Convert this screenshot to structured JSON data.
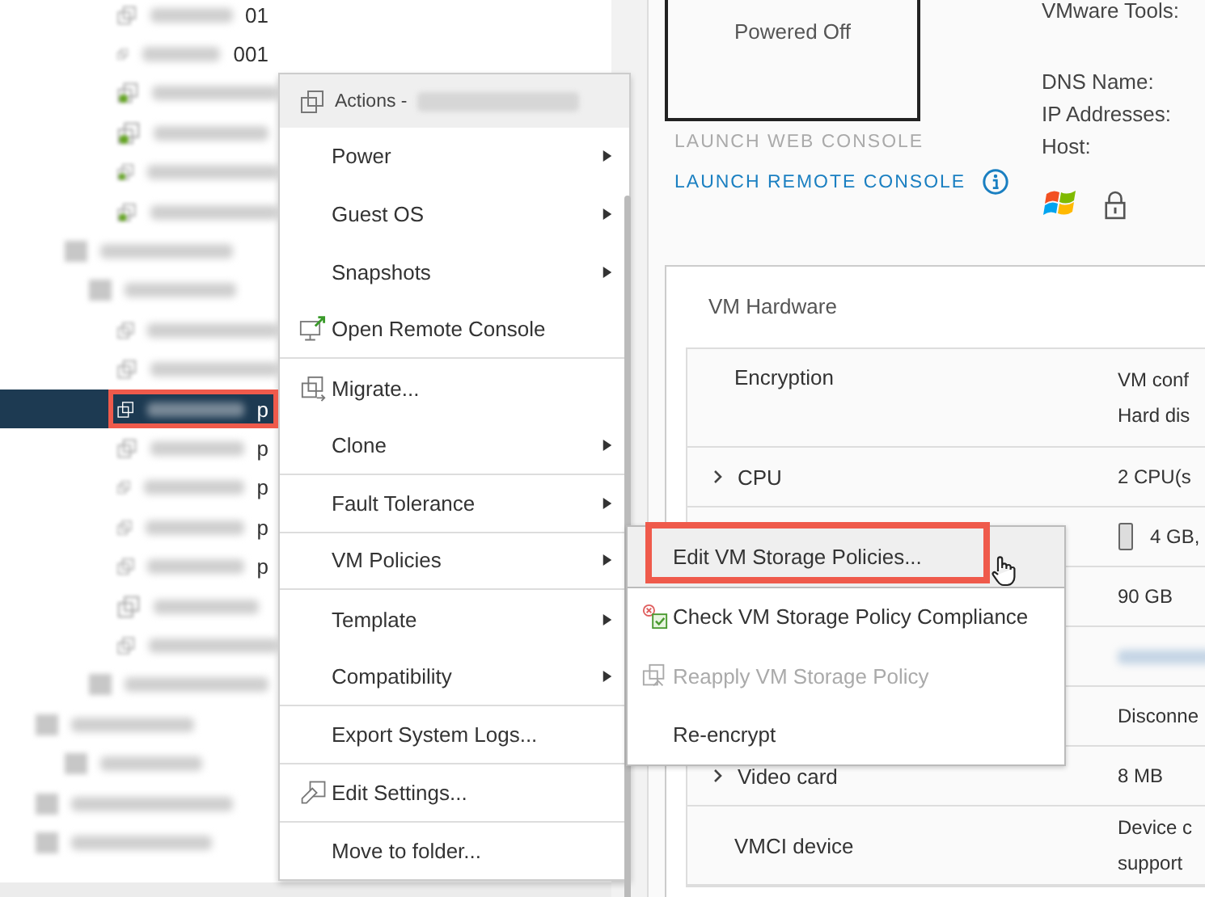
{
  "tree": {
    "rows": [
      {
        "kind": "vm",
        "text": "01",
        "selected": false
      },
      {
        "kind": "vm",
        "text": "001",
        "selected": false
      },
      {
        "kind": "vm-on",
        "selected": false
      },
      {
        "kind": "vm-on",
        "selected": false
      },
      {
        "kind": "vm-on",
        "selected": false
      },
      {
        "kind": "vm-on",
        "selected": false
      },
      {
        "kind": "host",
        "selected": false
      },
      {
        "kind": "pool",
        "selected": false
      },
      {
        "kind": "vm",
        "selected": false
      },
      {
        "kind": "vm",
        "selected": false
      },
      {
        "kind": "vm",
        "text": "p",
        "selected": true
      },
      {
        "kind": "vm",
        "text": "p",
        "selected": false
      },
      {
        "kind": "vm",
        "text": "p",
        "selected": false
      },
      {
        "kind": "vm",
        "text": "p",
        "selected": false
      },
      {
        "kind": "vm",
        "text": "p",
        "selected": false
      },
      {
        "kind": "vm",
        "selected": false
      },
      {
        "kind": "vm",
        "selected": false
      },
      {
        "kind": "pool",
        "selected": false
      },
      {
        "kind": "cluster",
        "selected": false
      },
      {
        "kind": "host",
        "selected": false
      },
      {
        "kind": "cluster",
        "selected": false
      },
      {
        "kind": "cluster",
        "selected": false
      }
    ]
  },
  "console": {
    "status": "Powered Off",
    "links": [
      {
        "label": "LAUNCH WEB CONSOLE",
        "disabled": true
      },
      {
        "label": "LAUNCH REMOTE CONSOLE",
        "disabled": false
      }
    ]
  },
  "summary_labels": [
    "VMware Tools:",
    "DNS Name:",
    "IP Addresses:",
    "Host:"
  ],
  "vm_hardware": {
    "title": "VM Hardware",
    "rows": [
      {
        "label": "Encryption",
        "values": [
          "VM conf",
          "Hard dis"
        ],
        "expandable": false
      },
      {
        "label": "CPU",
        "values": [
          "2 CPU(s"
        ],
        "expandable": true
      },
      {
        "kind": "memory",
        "values": [
          "4 GB,"
        ]
      },
      {
        "values": [
          "90 GB"
        ]
      },
      {
        "kind": "redacted",
        "values": []
      },
      {
        "values": [
          "Disconne"
        ]
      },
      {
        "label": "Video card",
        "values": [
          "8 MB"
        ],
        "expandable": true
      },
      {
        "label": "VMCI device",
        "values": [
          "Device c",
          "support"
        ],
        "expandable": false
      }
    ]
  },
  "context_menu": {
    "title": "Actions -",
    "items": [
      {
        "label": "Power",
        "submenu": true,
        "kind": "plain",
        "divider_after": false
      },
      {
        "label": "Guest OS",
        "submenu": true,
        "kind": "plain",
        "divider_after": false
      },
      {
        "label": "Snapshots",
        "submenu": true,
        "kind": "plain",
        "divider_after": false
      },
      {
        "label": "Open Remote Console",
        "submenu": false,
        "kind": "console",
        "divider_after": true
      },
      {
        "label": "Migrate...",
        "submenu": false,
        "kind": "migrate",
        "divider_after": false
      },
      {
        "label": "Clone",
        "submenu": true,
        "kind": "plain",
        "divider_after": true
      },
      {
        "label": "Fault Tolerance",
        "submenu": true,
        "kind": "plain",
        "divider_after": true
      },
      {
        "label": "VM Policies",
        "submenu": true,
        "kind": "plain",
        "divider_after": true
      },
      {
        "label": "Template",
        "submenu": true,
        "kind": "plain",
        "divider_after": false
      },
      {
        "label": "Compatibility",
        "submenu": true,
        "kind": "plain",
        "divider_after": true
      },
      {
        "label": "Export System Logs...",
        "submenu": false,
        "kind": "plain",
        "divider_after": true
      },
      {
        "label": "Edit Settings...",
        "submenu": false,
        "kind": "settings",
        "divider_after": true
      },
      {
        "label": "Move to folder...",
        "submenu": false,
        "kind": "plain",
        "divider_after": false
      }
    ]
  },
  "submenu": {
    "items": [
      {
        "label": "Edit VM Storage Policies...",
        "kind": "plain",
        "selected": true,
        "disabled": false
      },
      {
        "label": "Check VM Storage Policy Compliance",
        "kind": "check",
        "selected": false,
        "disabled": false
      },
      {
        "label": "Reapply VM Storage Policy",
        "kind": "reapply",
        "selected": false,
        "disabled": true
      },
      {
        "label": "Re-encrypt",
        "kind": "plain",
        "selected": false,
        "disabled": false
      }
    ]
  }
}
